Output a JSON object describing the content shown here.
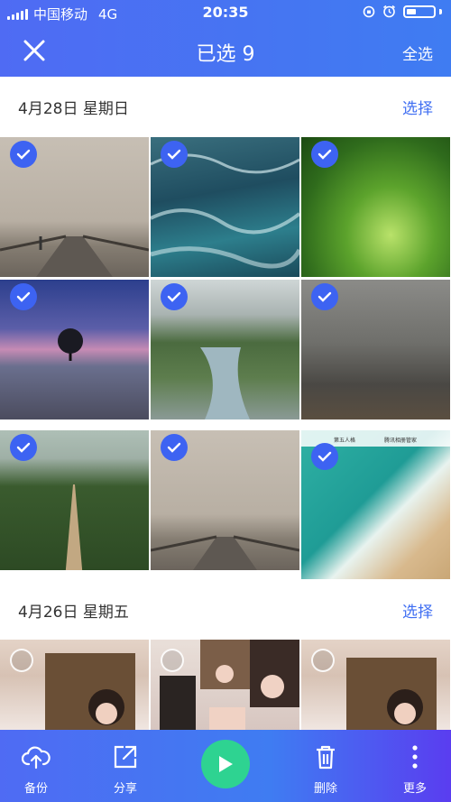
{
  "status_bar": {
    "carrier": "中国移动",
    "network": "4G",
    "time": "20:35"
  },
  "header": {
    "title": "已选 9",
    "select_all": "全选"
  },
  "sections": [
    {
      "date": "4月28日 星期日",
      "action": "选择"
    },
    {
      "date": "4月26日 星期五",
      "action": "选择"
    }
  ],
  "photos_apr28": [
    {
      "name": "foggy-bridge",
      "selected": true
    },
    {
      "name": "ocean-waves",
      "selected": true
    },
    {
      "name": "green-forest-path",
      "selected": true
    },
    {
      "name": "lone-tree-dusk",
      "selected": true
    },
    {
      "name": "canyon-river",
      "selected": true
    },
    {
      "name": "misty-forest",
      "selected": true
    },
    {
      "name": "forest-road",
      "selected": true
    },
    {
      "name": "foggy-bridge-2",
      "selected": true
    },
    {
      "name": "beach-screenshot",
      "selected": true
    }
  ],
  "screenshot_tile": {
    "app1": "第五人格",
    "app2": "腾讯相册管家"
  },
  "photos_apr26": [
    {
      "name": "girl-newspaper-1",
      "selected": false
    },
    {
      "name": "girl-collage",
      "selected": false
    },
    {
      "name": "girl-newspaper-2",
      "selected": false
    }
  ],
  "toolbar": {
    "backup": "备份",
    "share": "分享",
    "delete": "删除",
    "more": "更多"
  },
  "colors": {
    "accent": "#3f6ef2",
    "check": "#3d63f2",
    "play": "#2ed391"
  }
}
